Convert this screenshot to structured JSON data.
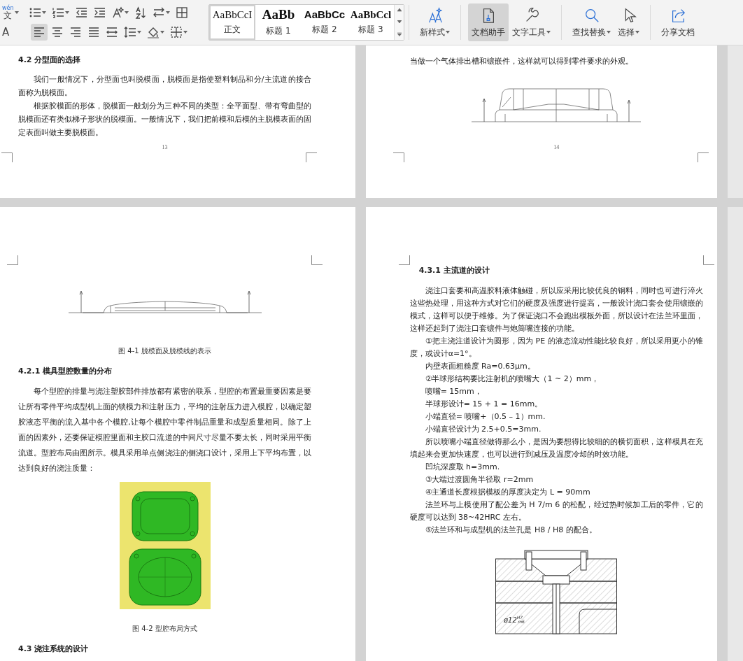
{
  "toolbar": {
    "row1": [
      {
        "kind": "pinyin",
        "top": "wén",
        "main": "文",
        "dropdown": true,
        "selected": false
      },
      {
        "kind": "bullets",
        "dropdown": true,
        "selected": false
      },
      {
        "kind": "numbering",
        "dropdown": true,
        "selected": false
      },
      {
        "kind": "outdent",
        "dropdown": false,
        "selected": false
      },
      {
        "kind": "indent",
        "dropdown": false,
        "selected": false
      },
      {
        "kind": "text-effect",
        "dropdown": true,
        "selected": false
      },
      {
        "kind": "sort",
        "dropdown": false,
        "selected": false
      },
      {
        "kind": "spacing",
        "dropdown": true,
        "selected": false
      },
      {
        "kind": "table",
        "dropdown": false,
        "selected": false
      }
    ],
    "row2": [
      {
        "kind": "glyph",
        "main": "A",
        "dropdown": false,
        "selected": false
      },
      {
        "kind": "align-left",
        "dropdown": false,
        "selected": true
      },
      {
        "kind": "align-center",
        "dropdown": false,
        "selected": false
      },
      {
        "kind": "align-right",
        "dropdown": false,
        "selected": false
      },
      {
        "kind": "justify",
        "dropdown": false,
        "selected": false
      },
      {
        "kind": "distribute",
        "dropdown": false,
        "selected": false
      },
      {
        "kind": "line-spacing",
        "dropdown": true,
        "selected": false
      },
      {
        "kind": "shading",
        "dropdown": true,
        "selected": false
      },
      {
        "kind": "borders",
        "dropdown": true,
        "selected": false
      }
    ]
  },
  "styles": [
    {
      "kind": "normal",
      "preview": "AaBbCcI",
      "label": "正文",
      "selected": true
    },
    {
      "kind": "h1",
      "preview": "AaBb",
      "label": "标题 1",
      "selected": false
    },
    {
      "kind": "h2",
      "preview": "AaBbCc",
      "label": "标题 2",
      "selected": false
    },
    {
      "kind": "h3",
      "preview": "AaBbCcl",
      "label": "标题 3",
      "selected": false
    }
  ],
  "buttons": [
    {
      "kind": "new-style",
      "label": "新样式",
      "dropdown": true,
      "selected": false,
      "divider_before": true
    },
    {
      "kind": "doc-helper",
      "label": "文档助手",
      "dropdown": false,
      "selected": true,
      "divider_before": true
    },
    {
      "kind": "tools",
      "label": "文字工具",
      "dropdown": true,
      "selected": false,
      "divider_before": false
    },
    {
      "kind": "search",
      "label": "查找替换",
      "dropdown": true,
      "selected": false,
      "divider_before": true
    },
    {
      "kind": "cursor",
      "label": "选择",
      "dropdown": true,
      "selected": false,
      "divider_before": false
    },
    {
      "kind": "share",
      "label": "分享文档",
      "dropdown": false,
      "selected": false,
      "divider_before": true
    }
  ],
  "page_rows": [
    {
      "pages": [
        {
          "blocks": [
            {
              "kind": "heading",
              "text": "4.2  分型面的选择"
            },
            {
              "kind": "para",
              "indent": true,
              "text": "我们一般情况下，分型面也叫脱模面，脱模面是指使塑料制品和分/主流道的接合面称为脱模面。"
            },
            {
              "kind": "para",
              "indent": true,
              "text": "根据胶模面的形体，脱模面一般划分为三种不同的类型：全平面型、带有弯曲型的脱模面还有类似梯子形状的脱模面。一般情况下，我们把前模和后模的主脱模表面的固定表面叫做主要脱模面。"
            }
          ],
          "page_number": "13"
        },
        {
          "blocks": [
            {
              "kind": "para",
              "indent": false,
              "text": "当做一个气体排出槽和镶嵌件，这样就可以得到零件要求的外观。"
            },
            {
              "kind": "profile"
            }
          ],
          "page_number": "14"
        }
      ]
    },
    {
      "pages": [
        {
          "blocks": [
            {
              "kind": "flatprofile"
            },
            {
              "kind": "caption",
              "text": "图 4-1  脱模面及脱模线的表示"
            },
            {
              "kind": "heading",
              "text": "4.2.1  模具型腔数量的分布"
            },
            {
              "kind": "para",
              "indent": true,
              "text": "每个型腔的排量与浇注塑胶部件排放都有紧密的联系，型腔的布置最重要因素是要让所有零件平均成型机上面的锁模力和注射压力，平均的注射压力进入模腔，以确定塑胶液态平衡的流入基中各个模腔,让每个模腔中零件制品重量和成型质量相同。除了上面的因素外，还要保证模腔里面和主胶口流道的中间尺寸尽量不要太长，同时采用平衡流道。型腔布局由图所示。模具采用单点侧浇注的侧浇口设计，采用上下平均布置，以达到良好的浇注质量："
            },
            {
              "kind": "cavities"
            },
            {
              "kind": "caption",
              "text": "图 4-2 型腔布局方式"
            },
            {
              "kind": "heading",
              "text": "4.3  浇注系统的设计"
            }
          ]
        },
        {
          "blocks": [
            {
              "kind": "heading",
              "text": "4.3.1  主流道的设计"
            },
            {
              "kind": "para",
              "indent": true,
              "text": "浇注口套要和高温胶料液体触碰，所以应采用比较优良的钢料，同时也可进行淬火这些热处理，用这种方式对它们的硬度及强度进行提高，一般设计浇口套会使用镶嵌的模式，这样可以便于维修。为了保证浇口不会跑出模板外面，所以设计在法兰环里面，这样还起到了浇注口套镶件与炮筒嘴连接的功能。"
            },
            {
              "kind": "para",
              "indent": true,
              "text": "①把主浇注道设计为圆形，因为 PE 的液态流动性能比较良好，所以采用更小的锥度，或设计α=1°。"
            },
            {
              "kind": "para",
              "indent": true,
              "text": "内壁表面粗糙度 Ra=0.63μm。"
            },
            {
              "kind": "para",
              "indent": true,
              "text": "②半球形结构要比注射机的喷嘴大（1 ~ 2）mm，"
            },
            {
              "kind": "para",
              "indent": true,
              "text": "喷嘴= 15mm，"
            },
            {
              "kind": "para",
              "indent": true,
              "text": "半球形设计= 15 + 1 = 16mm。"
            },
            {
              "kind": "para",
              "indent": true,
              "text": "小端直径= 喷嘴+（0.5 – 1）mm."
            },
            {
              "kind": "para",
              "indent": true,
              "text": "小端直径设计为 2.5+0.5=3mm."
            },
            {
              "kind": "para",
              "indent": true,
              "text": "所以喷嘴小端直径做得那么小，是因为要想得比较细的的横切面积，这样模具在充填起来会更加快速度，也可以进行到减压及温度冷却的时效功能。"
            },
            {
              "kind": "para",
              "indent": true,
              "text": "凹坑深度取 h=3mm."
            },
            {
              "kind": "para",
              "indent": true,
              "text": "③大端过渡圆角半径取 r=2mm"
            },
            {
              "kind": "para",
              "indent": true,
              "text": "④主通道长度根据模板的厚度决定为 L = 90mm"
            },
            {
              "kind": "para",
              "indent": true,
              "text": "法兰环与上模使用了配公差为 H 7/m 6 的松配，经过热时候加工后的零件，它的硬度可以达到 38~42HRC 左右。"
            },
            {
              "kind": "para",
              "indent": true,
              "text": "⑤法兰环和与成型机的法兰孔是 H8 / H8 的配合。"
            },
            {
              "kind": "sprue",
              "dimension": {
                "text": "ø12",
                "upper": "H7",
                "lower": "m6"
              }
            }
          ]
        }
      ]
    }
  ]
}
